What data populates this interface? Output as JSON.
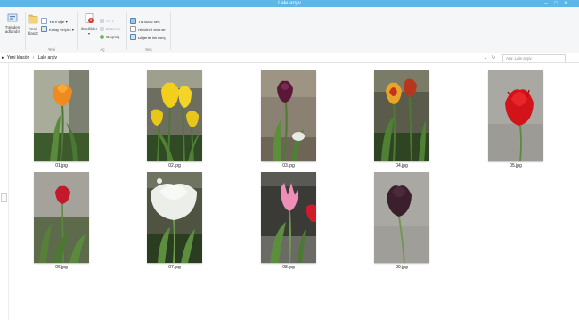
{
  "window": {
    "title": "Lale arşiv",
    "controls": {
      "minimize": "–",
      "maximize": "□",
      "close": "×"
    }
  },
  "ribbon": {
    "clipboard": {
      "copy_path_label": "Tümden adlandır"
    },
    "new_group": {
      "label": "Yeni",
      "new_folder": "Yeni klasör",
      "new_item": "Yeni öğe ▾",
      "easy_access": "Kolay erişim ▾"
    },
    "open_group": {
      "label": "Aç",
      "properties": "Özellikler",
      "open": "Aç ▾",
      "edit": "Düzenle",
      "history": "Geçmiş"
    },
    "select_group": {
      "label": "Seç",
      "select_all": "Tümünü seç",
      "select_none": "Hiçbirini seçme",
      "invert": "Diğerlerinin seç"
    }
  },
  "address": {
    "crumbs": [
      "Yeni klasör",
      "Lale arşiv"
    ],
    "search_placeholder": "Ara: Lale arşiv"
  },
  "files": [
    {
      "name": "01.jpg",
      "flower": "tulip-orange"
    },
    {
      "name": "02.jpg",
      "flower": "tulip-yellow-cluster"
    },
    {
      "name": "03.jpg",
      "flower": "tulip-dark-purple"
    },
    {
      "name": "04.jpg",
      "flower": "tulip-flame"
    },
    {
      "name": "05.jpg",
      "flower": "tulip-red"
    },
    {
      "name": "06.jpg",
      "flower": "tulip-red-small"
    },
    {
      "name": "07.jpg",
      "flower": "tulip-white"
    },
    {
      "name": "08.jpg",
      "flower": "tulip-pink"
    },
    {
      "name": "09.jpg",
      "flower": "tulip-black"
    }
  ],
  "colors": {
    "titlebar": "#5eb6e6",
    "ribbon": "#f5f6f7",
    "folder_yellow": "#e8c25b"
  }
}
